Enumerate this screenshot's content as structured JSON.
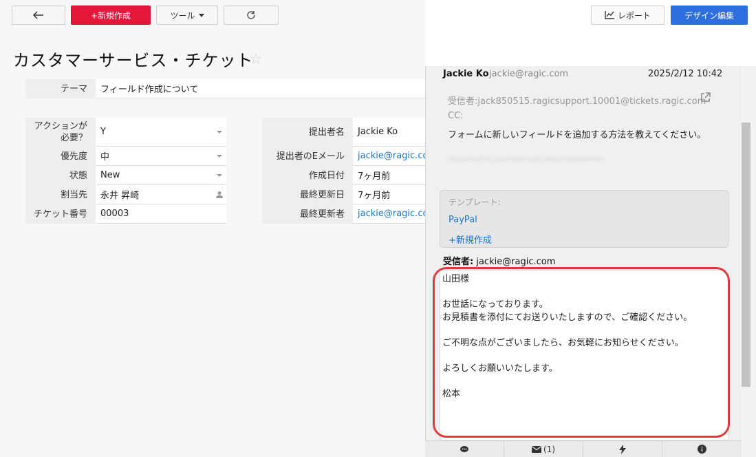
{
  "toolbar": {
    "back_icon": "arrow-left-icon",
    "new_label": "+新規作成",
    "tools_label": "ツール",
    "reload_icon": "reload-icon",
    "report_label": "レポート",
    "design_label": "デザイン編集",
    "accent_color": "#e4163a",
    "design_color": "#2e6fe0"
  },
  "page": {
    "title": "カスタマーサービス・チケット"
  },
  "form": {
    "theme_label": "テーマ",
    "theme_value": "フィールド作成について",
    "left_fields": [
      {
        "label": "アクションが必要？",
        "value": "Y"
      },
      {
        "label": "優先度",
        "value": "中"
      },
      {
        "label": "状態",
        "value": "New"
      },
      {
        "label": "割当先",
        "value": "永井 昇崎"
      },
      {
        "label": "チケット番号",
        "value": "00003"
      }
    ],
    "right_fields": [
      {
        "label": "提出者名",
        "value": "Jackie Ko"
      },
      {
        "label": "提出者のEメール",
        "value": "jackie@ragic.com"
      },
      {
        "label": "作成日付",
        "value": "7ヶ月前"
      },
      {
        "label": "最終更新日",
        "value": "7ヶ月前"
      },
      {
        "label": "最終更新者",
        "value": "jackie@ragic.com"
      }
    ]
  },
  "email_panel": {
    "sender_name": "Jackie Ko",
    "sender_email": "jackie@ragic.com",
    "date": "2025/2/12 10:42",
    "recipient": "受信者:jack850515.ragicsupport.10001@tickets.ragic.com",
    "cc": "CC:",
    "message": "フォームに新しいフィールドを追加する方法を教えてください。",
    "blurred_line": "response/t/01/sample/ragic/attached/address",
    "template_label": "テンプレート:",
    "templates": [
      "PayPal",
      "+新規作成"
    ],
    "to_label": "受信者:",
    "to_value": "jackie@ragic.com",
    "reply_text": "山田様\n\nお世話になっております。\nお見積書を添付にてお送りいたしますので、ご確認ください。\n\nご不明な点がございましたら、お気軽にお知らせください。\n\nよろしくお願いいたします。\n\n松本",
    "highlight_color": "#e5383b"
  },
  "bottom_tabs": {
    "comments_icon": "comment-icon",
    "mail_icon": "mail-icon",
    "mail_count": "(1)",
    "action_icon": "lightning-icon",
    "info_icon": "info-icon"
  }
}
